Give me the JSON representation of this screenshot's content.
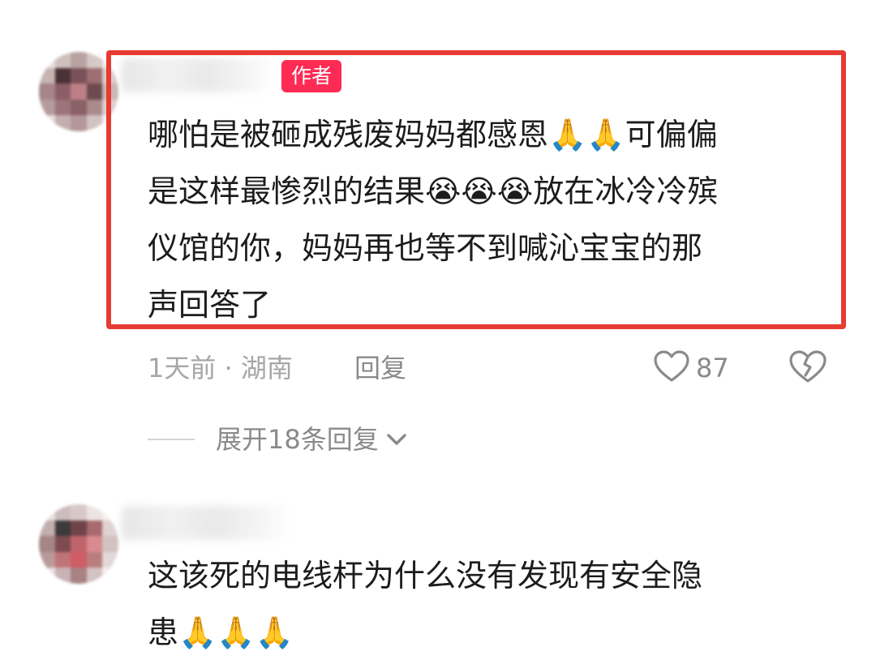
{
  "comments": [
    {
      "author_badge": "作者",
      "text": "哪怕是被砸成残废妈妈都感恩🙏🙏可偏偏\n是这样最惨烈的结果😭😭😭放在冰冷冷殡\n仪馆的你，妈妈再也等不到喊沁宝宝的那\n声回答了",
      "meta": "1天前 · 湖南",
      "reply_label": "回复",
      "like_count": "87",
      "expand_label": "展开18条回复"
    },
    {
      "text": "这该死的电线杆为什么没有发现有安全隐\n患🙏🙏🙏"
    }
  ],
  "colors": {
    "author_badge_bg": "#fe2c55",
    "highlight_border": "#e63b33",
    "text_primary": "#1c1c1c",
    "text_secondary": "#a6a6a6"
  },
  "icons": {
    "like": "heart-outline-icon",
    "dislike": "broken-heart-icon",
    "expand": "chevron-down-icon"
  }
}
